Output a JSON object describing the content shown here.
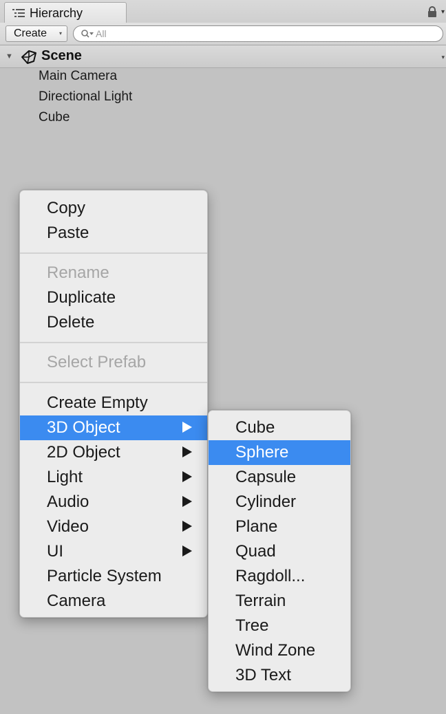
{
  "window": {
    "tab_label": "Hierarchy",
    "icons": {
      "tab": "hierarchy-list-icon",
      "lock": "lock-icon",
      "tab_menu": "dropdown-triangle-icon"
    }
  },
  "toolbar": {
    "create_label": "Create",
    "create_caret": "▾",
    "search_placeholder": "All",
    "search_value": ""
  },
  "scene": {
    "label": "Scene",
    "expanded": true,
    "fold_glyph": "▼",
    "menu_glyph": "▾",
    "items": [
      {
        "label": "Main Camera"
      },
      {
        "label": "Directional Light"
      },
      {
        "label": "Cube"
      }
    ]
  },
  "context_menu": {
    "groups": [
      [
        {
          "label": "Copy",
          "enabled": true
        },
        {
          "label": "Paste",
          "enabled": true
        }
      ],
      [
        {
          "label": "Rename",
          "enabled": false
        },
        {
          "label": "Duplicate",
          "enabled": true
        },
        {
          "label": "Delete",
          "enabled": true
        }
      ],
      [
        {
          "label": "Select Prefab",
          "enabled": false
        }
      ],
      [
        {
          "label": "Create Empty",
          "enabled": true
        },
        {
          "label": "3D Object",
          "enabled": true,
          "submenu": true,
          "highlighted": true
        },
        {
          "label": "2D Object",
          "enabled": true,
          "submenu": true
        },
        {
          "label": "Light",
          "enabled": true,
          "submenu": true
        },
        {
          "label": "Audio",
          "enabled": true,
          "submenu": true
        },
        {
          "label": "Video",
          "enabled": true,
          "submenu": true
        },
        {
          "label": "UI",
          "enabled": true,
          "submenu": true
        },
        {
          "label": "Particle System",
          "enabled": true
        },
        {
          "label": "Camera",
          "enabled": true
        }
      ]
    ]
  },
  "submenu_3d_object": {
    "items": [
      {
        "label": "Cube"
      },
      {
        "label": "Sphere",
        "highlighted": true
      },
      {
        "label": "Capsule"
      },
      {
        "label": "Cylinder"
      },
      {
        "label": "Plane"
      },
      {
        "label": "Quad"
      },
      {
        "label": "Ragdoll..."
      },
      {
        "label": "Terrain"
      },
      {
        "label": "Tree"
      },
      {
        "label": "Wind Zone"
      },
      {
        "label": "3D Text"
      }
    ]
  },
  "colors": {
    "panel_bg": "#c2c2c2",
    "menu_bg": "#ececec",
    "highlight": "#3b8bf0",
    "highlight_text": "#ffffff",
    "disabled_text": "#a6a6a6"
  }
}
